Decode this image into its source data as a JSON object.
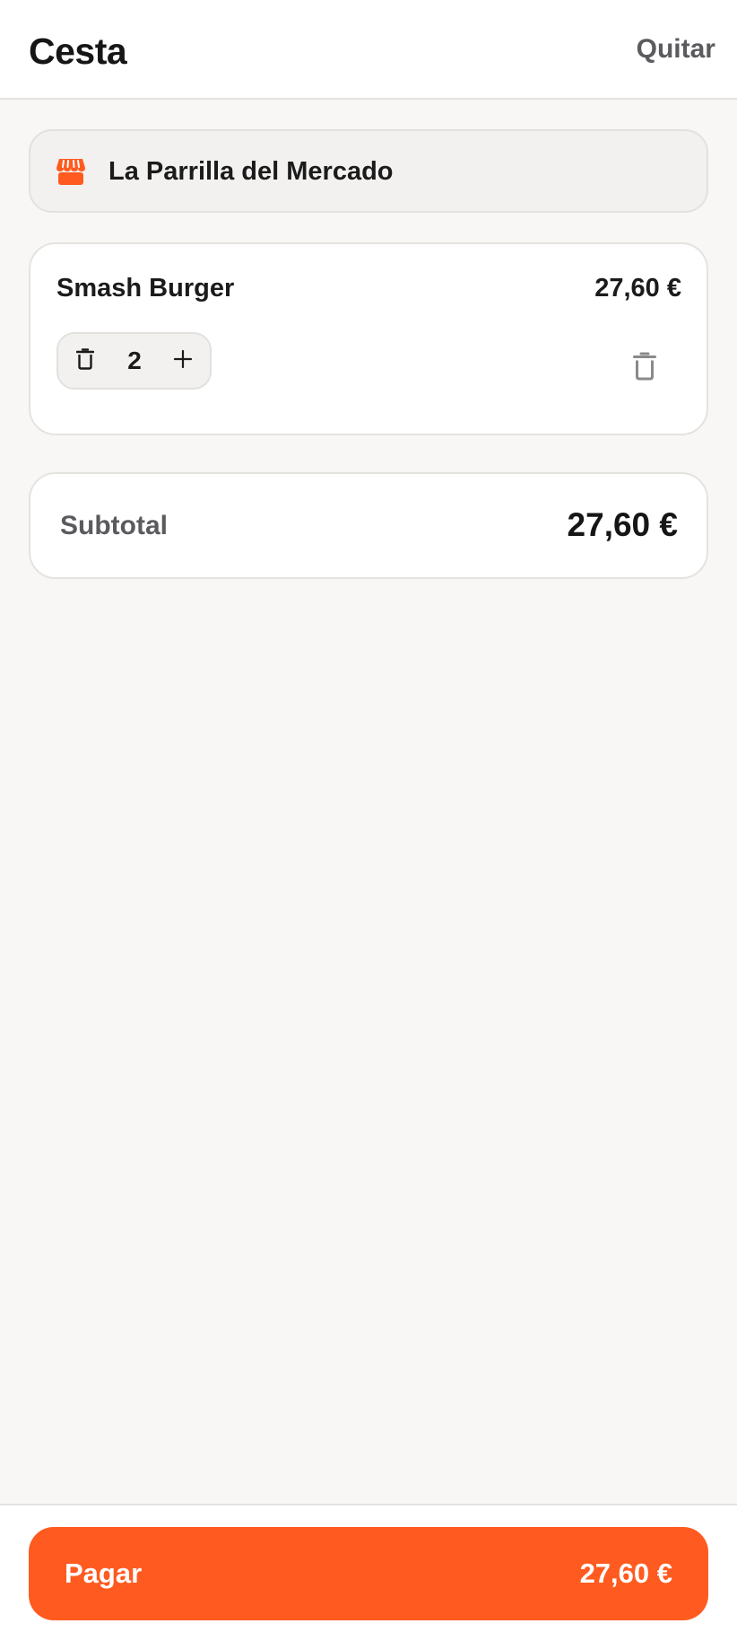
{
  "header": {
    "title": "Cesta",
    "action_label": "Quitar"
  },
  "restaurant": {
    "icon": "store-icon",
    "name": "La Parrilla del Mercado"
  },
  "cart": {
    "items": [
      {
        "name": "Smash Burger",
        "price": "27,60 €",
        "quantity": "2",
        "decrement_icon": "trash-icon",
        "increment_icon": "plus-icon",
        "remove_icon": "trash-icon"
      }
    ]
  },
  "summary": {
    "subtotal_label": "Subtotal",
    "subtotal_value": "27,60 €"
  },
  "checkout": {
    "button_label": "Pagar",
    "button_amount": "27,60 €"
  },
  "colors": {
    "accent": "#ff5a1f",
    "background": "#f8f7f5",
    "text_primary": "#1b1b1b",
    "text_secondary": "#5b5b5f"
  }
}
